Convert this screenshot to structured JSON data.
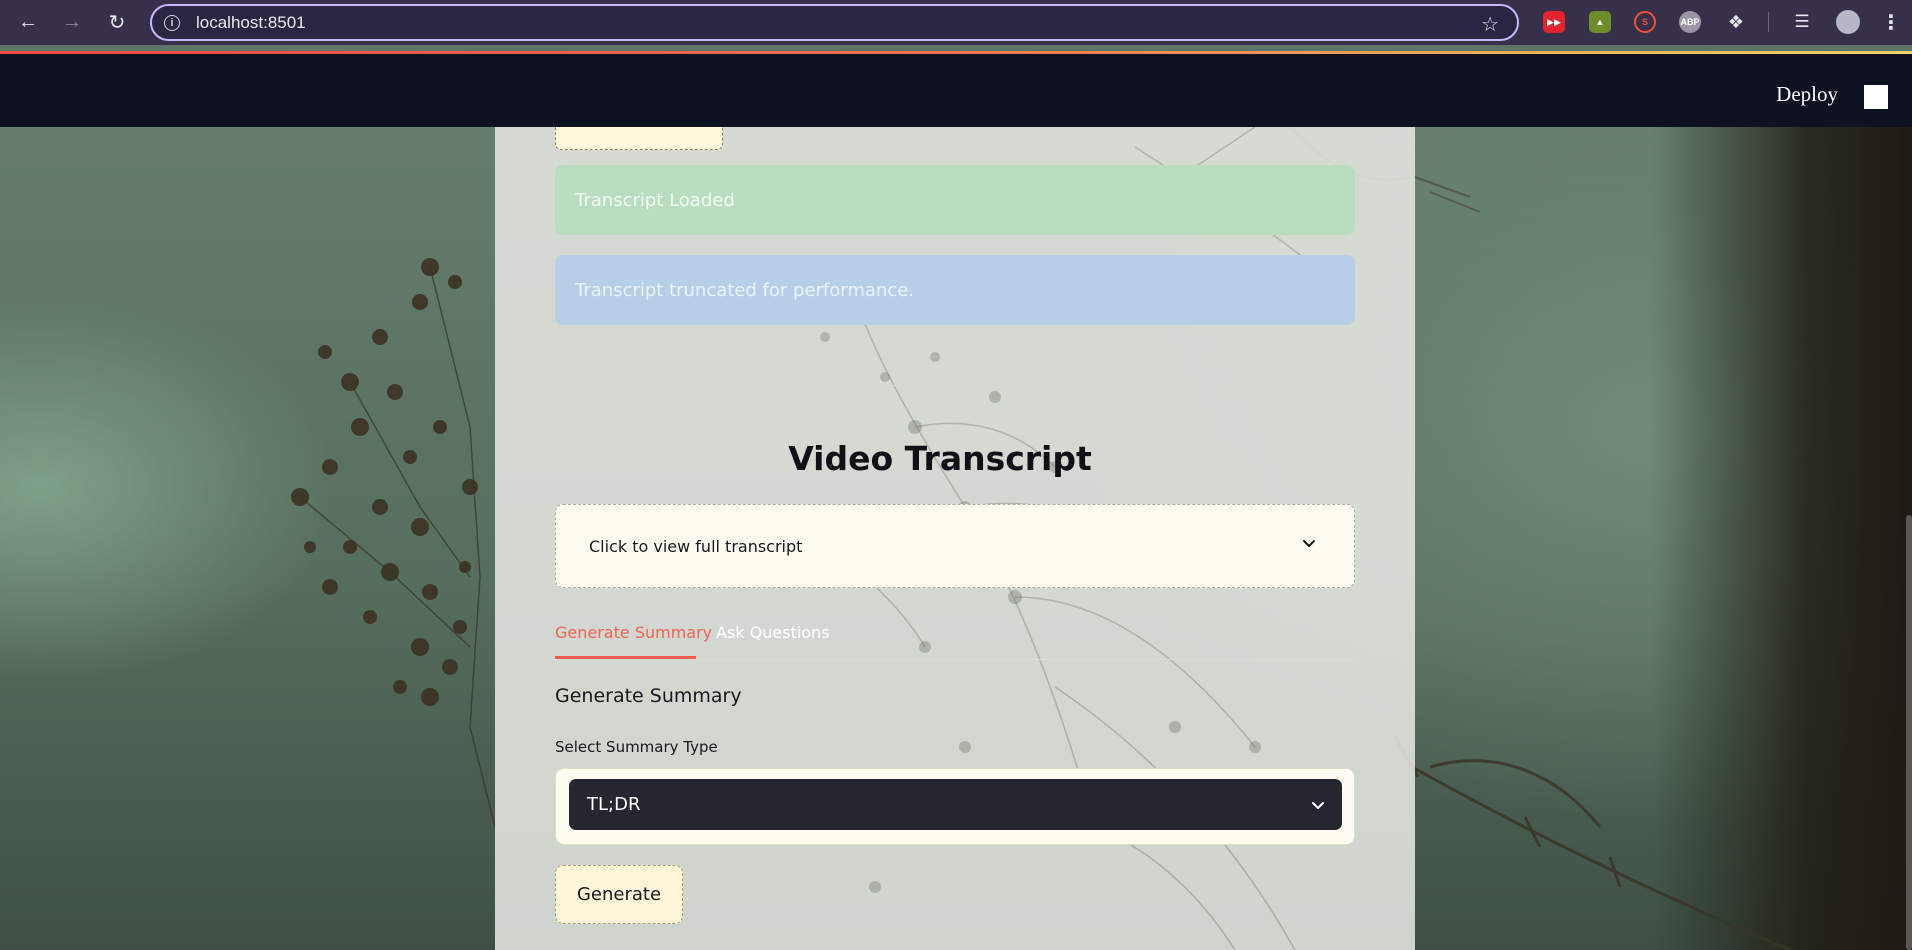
{
  "browser": {
    "url": "localhost:8501",
    "extensions": [
      "youtube-extension-icon",
      "image-extension-icon",
      "s-extension-icon",
      "abp-icon",
      "puzzle-icon"
    ],
    "abp_label": "ABP"
  },
  "header": {
    "deploy_label": "Deploy"
  },
  "alerts": {
    "success": "Transcript Loaded",
    "info": "Transcript truncated for performance."
  },
  "transcript": {
    "title": "Video Transcript",
    "expander_label": "Click to view full transcript"
  },
  "tabs": [
    {
      "label": "Generate Summary",
      "active": true
    },
    {
      "label": "Ask Questions",
      "active": false
    }
  ],
  "summary": {
    "heading": "Generate Summary",
    "select_label": "Select Summary Type",
    "select_value": "TL;DR",
    "generate_label": "Generate"
  },
  "colors": {
    "header_bg": "#0e1120",
    "accent": "#f25a4d",
    "select_bg": "#262631",
    "success_bg": "#b9ddbf",
    "info_bg": "#b6cfe6"
  }
}
